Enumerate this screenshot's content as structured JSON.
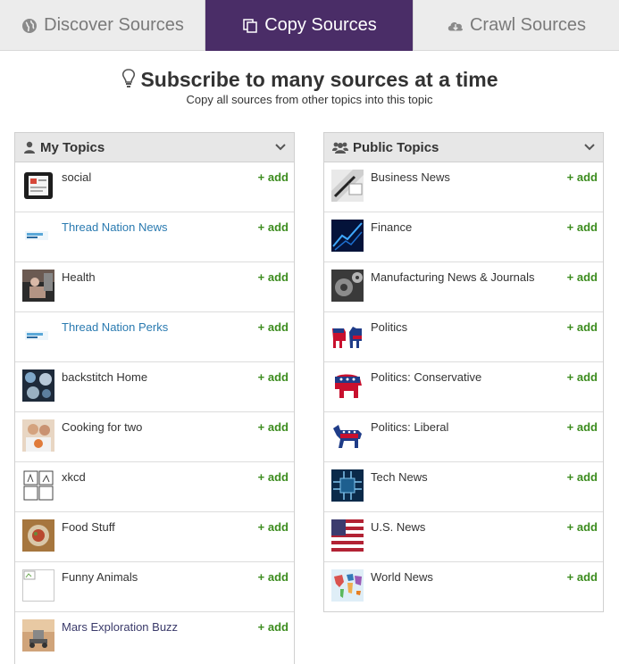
{
  "tabs": [
    {
      "label": "Discover Sources",
      "icon": "globe-icon"
    },
    {
      "label": "Copy Sources",
      "icon": "copy-icon",
      "active": true
    },
    {
      "label": "Crawl Sources",
      "icon": "cloud-download-icon"
    }
  ],
  "colors": {
    "active_tab": "#4a2d67",
    "add": "#3c8c1e",
    "link": "#2a7ab0"
  },
  "header": {
    "title": "Subscribe to many sources at a time",
    "subtitle": "Copy all sources from other topics into this topic"
  },
  "my_topics": {
    "title": "My Topics",
    "items": [
      {
        "name": "social",
        "action": "+ add"
      },
      {
        "name": "Thread Nation News",
        "action": "+ add"
      },
      {
        "name": "Health",
        "action": "+ add"
      },
      {
        "name": "Thread Nation Perks",
        "action": "+ add"
      },
      {
        "name": "backstitch Home",
        "action": "+ add"
      },
      {
        "name": "Cooking for two",
        "action": "+ add"
      },
      {
        "name": "xkcd",
        "action": "+ add"
      },
      {
        "name": "Food Stuff",
        "action": "+ add"
      },
      {
        "name": "Funny Animals",
        "action": "+ add"
      },
      {
        "name": "Mars Exploration Buzz",
        "action": "+ add"
      }
    ]
  },
  "public_topics": {
    "title": "Public Topics",
    "items": [
      {
        "name": "Business News",
        "action": "+ add"
      },
      {
        "name": "Finance",
        "action": "+ add"
      },
      {
        "name": "Manufacturing News & Journals",
        "action": "+ add"
      },
      {
        "name": "Politics",
        "action": "+ add"
      },
      {
        "name": "Politics: Conservative",
        "action": "+ add"
      },
      {
        "name": "Politics: Liberal",
        "action": "+ add"
      },
      {
        "name": "Tech News",
        "action": "+ add"
      },
      {
        "name": "U.S. News",
        "action": "+ add"
      },
      {
        "name": "World News",
        "action": "+ add"
      }
    ]
  }
}
